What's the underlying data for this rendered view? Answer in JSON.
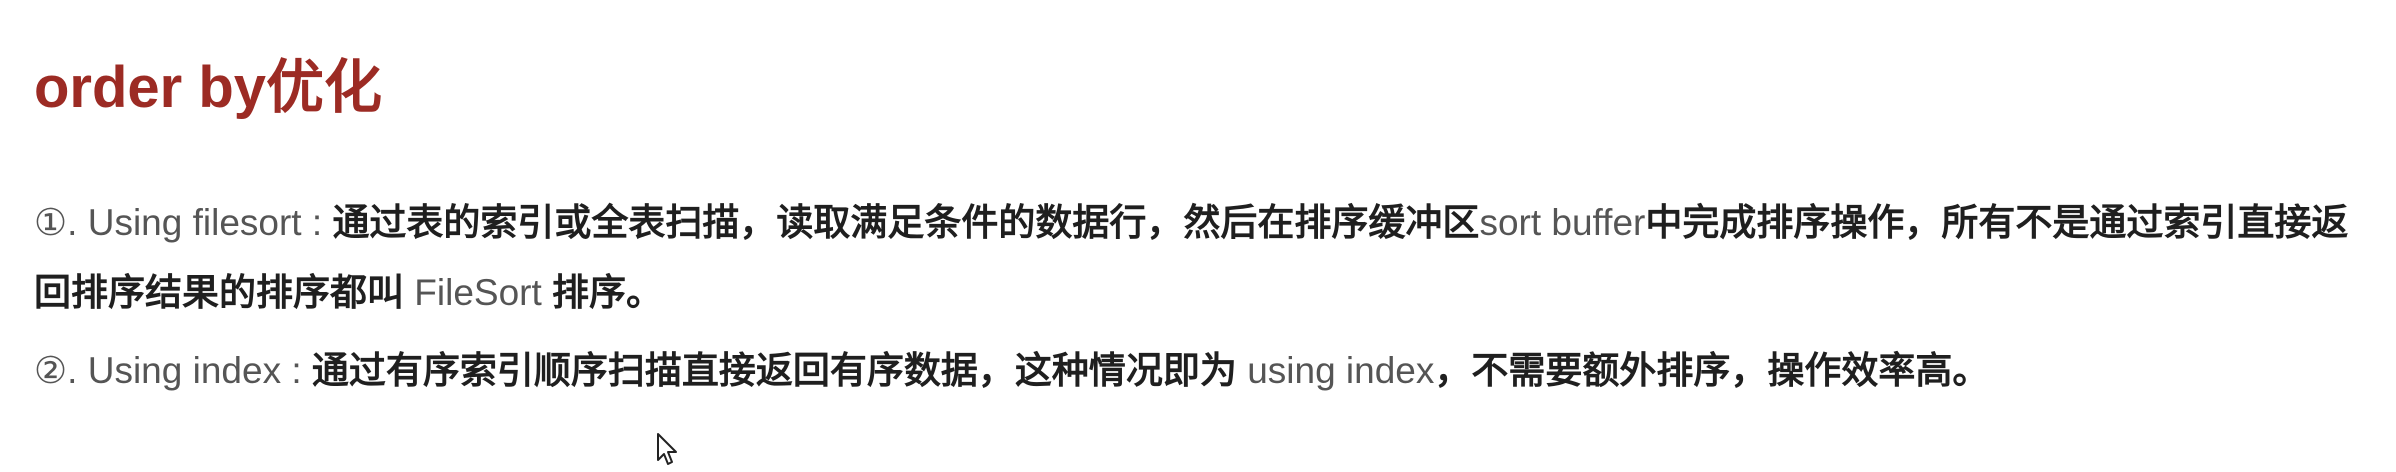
{
  "title": "order by优化",
  "items": [
    {
      "marker": "①. ",
      "term": "Using filesort : ",
      "text1": "通过表的索引或全表扫描，读取满足条件的数据行，然后在排序缓冲区",
      "en1": "sort buffer",
      "text2": "中完成排序操作，所有不是通过索引直接返回排序结果的排序都叫 ",
      "en2": "FileSort",
      "text3": " 排序。"
    },
    {
      "marker": "②. ",
      "term": "Using index : ",
      "text1": "通过有序索引顺序扫描直接返回有序数据，这种情况即为 ",
      "en1": "using index",
      "text2": "，不需要额外排序，操作效率高。"
    }
  ],
  "icons": {
    "cursor": "mouse-pointer-icon"
  }
}
